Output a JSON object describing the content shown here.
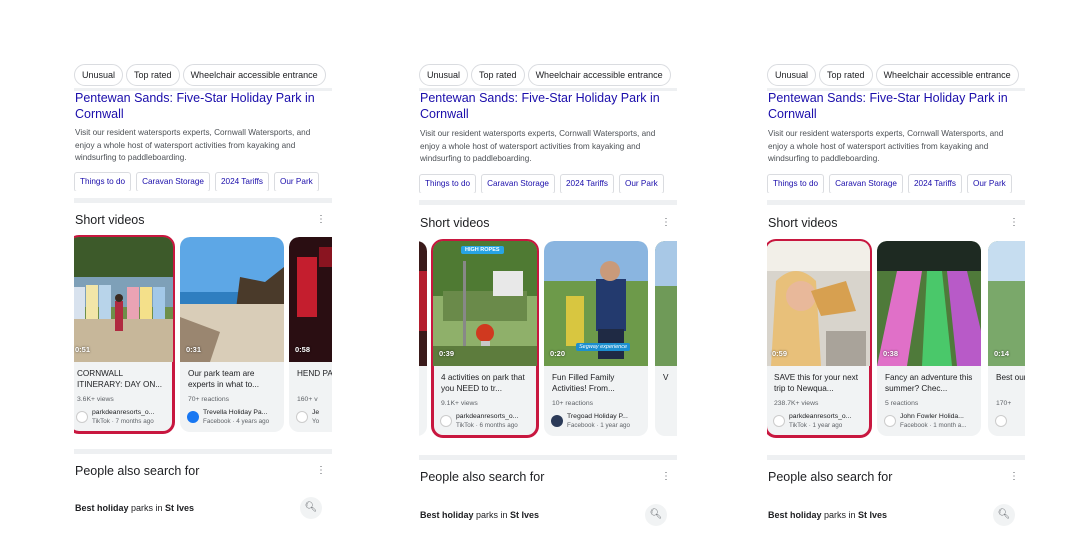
{
  "chips": [
    "Unusual",
    "Top rated",
    "Wheelchair accessible entrance"
  ],
  "result": {
    "title": "Pentewan Sands: Five-Star Holiday Park in Cornwall",
    "description": "Visit our resident watersports experts, Cornwall Watersports, and enjoy a whole host of watersport activities from kayaking and windsurfing to paddleboarding.",
    "links": [
      "Things to do",
      "Caravan Storage",
      "2024 Tariffs",
      "Our Park"
    ]
  },
  "short_videos_heading": "Short videos",
  "more_icon": "more-vert-icon",
  "people_also_search": {
    "heading": "People also search for",
    "query_bold1": "Best holiday",
    "query_mid": " parks in ",
    "query_bold2": "St Ives",
    "icon": "search-icon"
  },
  "panels": [
    {
      "cards": [
        {
          "duration": "0:51",
          "title": "CORNWALL ITINERARY: DAY ON...",
          "meta": "3.6K+ views",
          "source": "parkdeanresorts_o...",
          "sub": "TikTok · 7 months ago",
          "highlight": true
        },
        {
          "duration": "0:31",
          "title": "Our park team are experts in what to...",
          "meta": "70+ reactions",
          "source": "Trevella Holiday Pa...",
          "sub": "Facebook · 4 years ago",
          "highlight": false
        },
        {
          "duration": "0:58",
          "title": "HEND PARK",
          "meta": "160+ v",
          "source": "Je",
          "sub": "Yo",
          "highlight": false
        }
      ]
    },
    {
      "cards": [
        {
          "duration": "",
          "title": "",
          "meta": "",
          "source": "",
          "sub": "",
          "highlight": false
        },
        {
          "duration": "0:39",
          "title": "4 activities on park that you NEED to tr...",
          "meta": "9.1K+ views",
          "source": "parkdeanresorts_o...",
          "sub": "TikTok · 6 months ago",
          "highlight": true,
          "tag": "HIGH ROPES"
        },
        {
          "duration": "0:20",
          "title": "Fun Filled Family Activities! From...",
          "meta": "10+ reactions",
          "source": "Tregoad Holiday P...",
          "sub": "Facebook · 1 year ago",
          "highlight": false,
          "tag": "Segway experience"
        },
        {
          "duration": "",
          "title": "V",
          "meta": "",
          "source": "",
          "sub": "",
          "highlight": false
        }
      ]
    },
    {
      "cards": [
        {
          "duration": "0:59",
          "title": "SAVE this for your next trip to Newqua...",
          "meta": "238.7K+ views",
          "source": "parkdeanresorts_o...",
          "sub": "TikTok · 1 year ago",
          "highlight": true
        },
        {
          "duration": "0:38",
          "title": "Fancy an adventure this summer? Chec...",
          "meta": "5 reactions",
          "source": "John Fowler Holida...",
          "sub": "Facebook · 1 month a...",
          "highlight": false
        },
        {
          "duration": "0:14",
          "title": "Best our T",
          "meta": "170+",
          "source": "",
          "sub": "",
          "highlight": false
        }
      ]
    }
  ]
}
